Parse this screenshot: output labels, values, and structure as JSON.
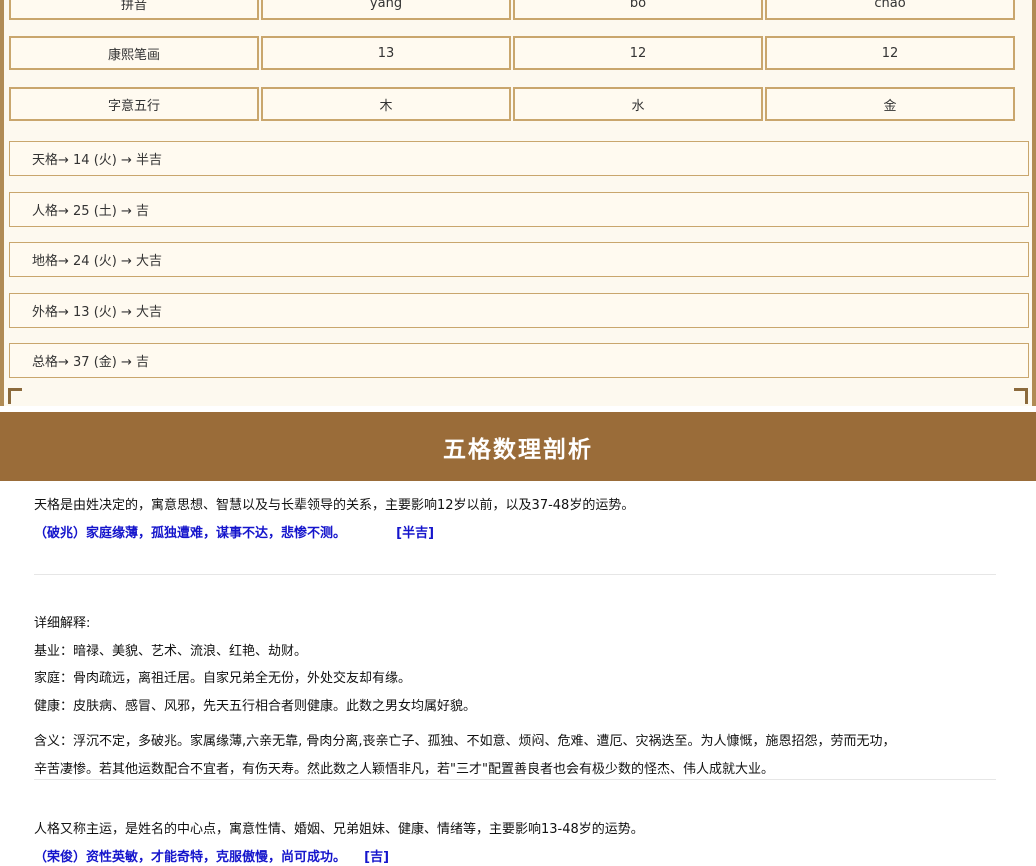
{
  "table": {
    "pinyin": {
      "label": "拼音",
      "c1": "yang",
      "c2": "bo",
      "c3": "chao"
    },
    "strokes": {
      "label": "康熙笔画",
      "c1": "13",
      "c2": "12",
      "c3": "12"
    },
    "wuxing": {
      "label": "字意五行",
      "c1": "木",
      "c2": "水",
      "c3": "金"
    }
  },
  "grids": [
    "天格→ 14 (火) → 半吉",
    "人格→ 25 (土) → 吉",
    "地格→ 24 (火) → 大吉",
    "外格→ 13 (火) → 大吉",
    "总格→ 37 (金) → 吉"
  ],
  "section": {
    "title": "五格数理剖析"
  },
  "tiange": {
    "intro": "天格是由姓决定的，寓意思想、智慧以及与长辈领导的关系，主要影响12岁以前，以及37-48岁的运势。",
    "verdict": "（破兆）家庭缘薄，孤独遭难，谋事不达，悲惨不测。",
    "tag": "[半吉]",
    "detail_title": "详细解释:",
    "jiye": "基业：暗禄、美貌、艺术、流浪、红艳、劫财。",
    "jiating": "家庭：骨肉疏远，离祖迁居。自家兄弟全无份，外处交友却有缘。",
    "jiankang": "健康：皮肤病、感冒、风邪，先天五行相合者则健康。此数之男女均属好貌。",
    "hanyi1": "含义：浮沉不定，多破兆。家属缘薄,六亲无靠, 骨肉分离,丧亲亡子、孤独、不如意、烦闷、危难、遭厄、灾祸迭至。为人慷慨，施恩招怨，劳而无功，",
    "hanyi2": "辛苦凄惨。若其他运数配合不宜者，有伤天寿。然此数之人颖悟非凡，若\"三才\"配置善良者也会有极少数的怪杰、伟人成就大业。"
  },
  "renge": {
    "intro": "人格又称主运，是姓名的中心点，寓意性情、婚姻、兄弟姐妹、健康、情绪等，主要影响13-48岁的运势。",
    "verdict": "（荣俊）资性英敏，才能奇特，克服傲慢，尚可成功。",
    "tag": "[吉]"
  }
}
